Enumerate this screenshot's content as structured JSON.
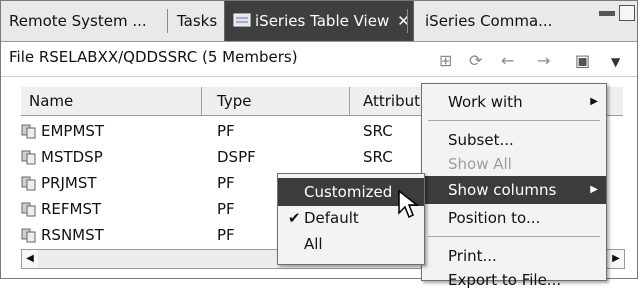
{
  "tabs": [
    {
      "label": "Remote System ...",
      "active": false
    },
    {
      "label": "Tasks",
      "active": false
    },
    {
      "label": "iSeries Table View",
      "active": true,
      "close": "✕"
    },
    {
      "label": "iSeries Comma...",
      "active": false
    }
  ],
  "view": {
    "title": "File RSELABXX/QDDSSRC (5 Members)"
  },
  "toolbar_icons": [
    "filter-icon",
    "refresh-icon",
    "back-arrow-icon",
    "forward-arrow-icon",
    "view-menu-icon",
    "dropdown-icon"
  ],
  "table": {
    "columns": [
      "Name",
      "Type",
      "Attribut"
    ],
    "rows": [
      {
        "name": "EMPMST",
        "type": "PF",
        "attr": "SRC"
      },
      {
        "name": "MSTDSP",
        "type": "DSPF",
        "attr": "SRC"
      },
      {
        "name": "PRJMST",
        "type": "PF",
        "attr": ""
      },
      {
        "name": "REFMST",
        "type": "PF",
        "attr": ""
      },
      {
        "name": "RSNMST",
        "type": "PF",
        "attr": ""
      }
    ]
  },
  "main_menu": {
    "items": [
      {
        "label": "Work with",
        "submenu": true,
        "enabled": true
      },
      {
        "label": "Subset...",
        "enabled": true
      },
      {
        "label": "Show All",
        "enabled": false
      },
      {
        "label": "Show columns",
        "submenu": true,
        "highlighted": true,
        "enabled": true
      },
      {
        "label": "Position to...",
        "enabled": true
      },
      {
        "label": "Print...",
        "enabled": true
      },
      {
        "label": "Export to File...",
        "enabled": true
      }
    ]
  },
  "columns_submenu": {
    "items": [
      {
        "label": "Customized",
        "highlighted": true
      },
      {
        "label": "Default",
        "checked": true
      },
      {
        "label": "All"
      }
    ]
  }
}
